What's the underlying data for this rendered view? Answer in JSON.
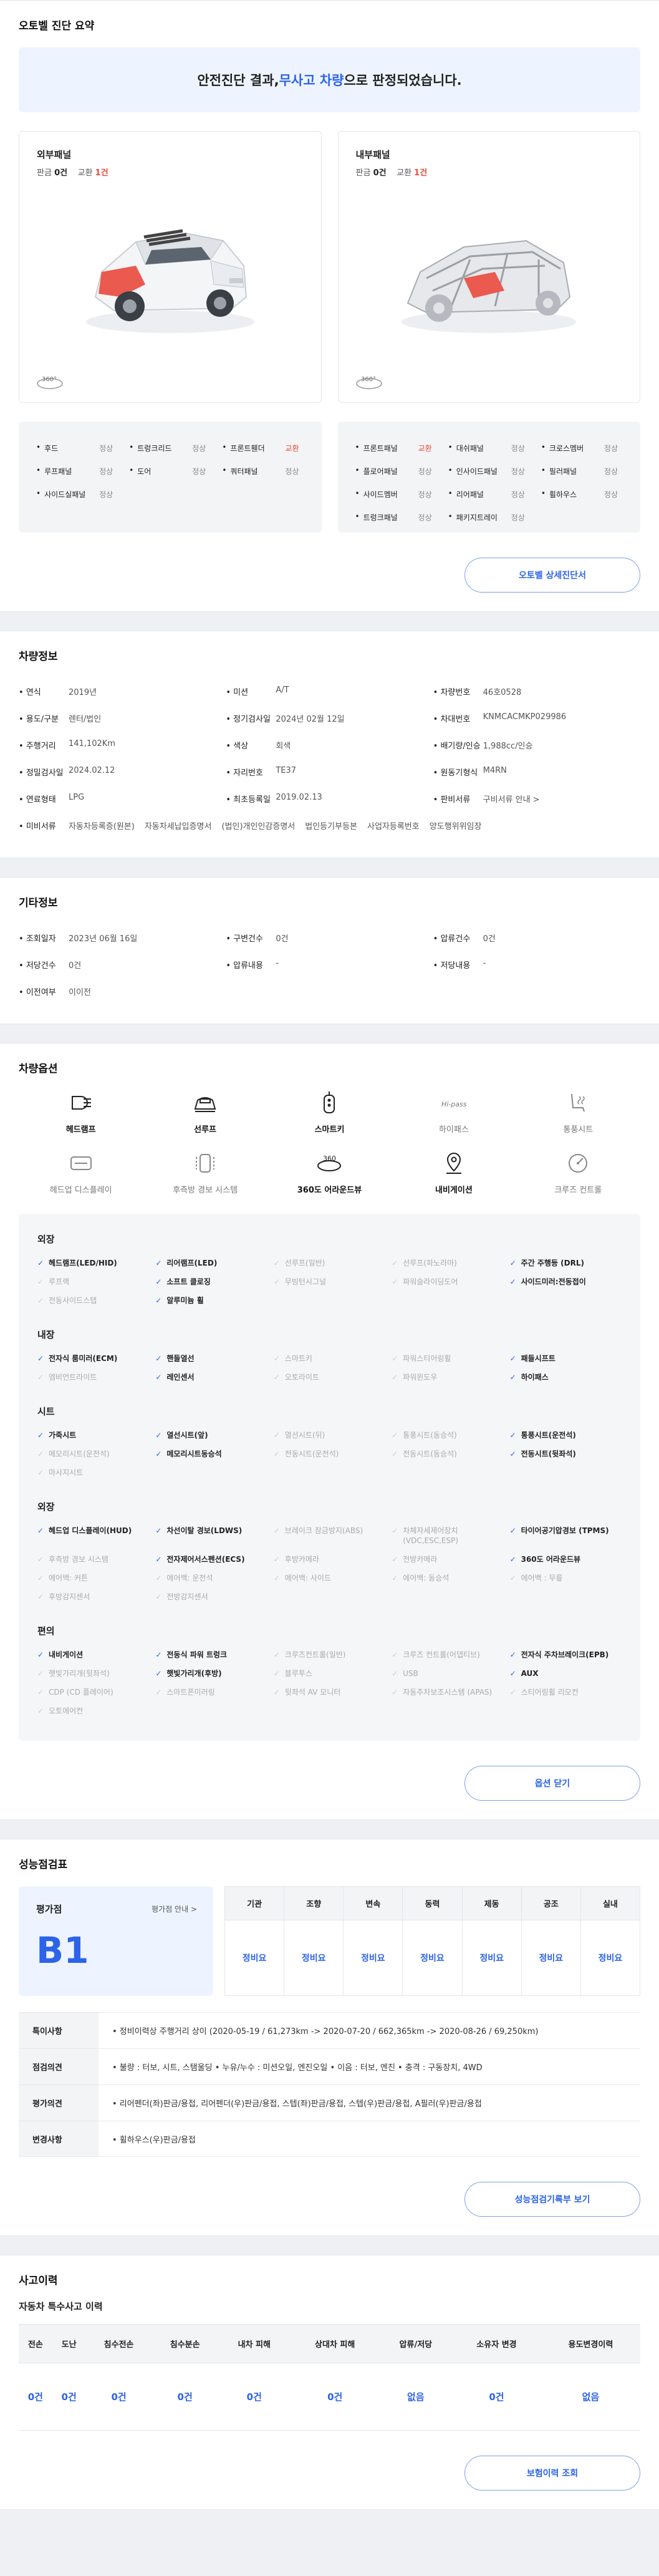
{
  "summary": {
    "title": "오토벨 진단 요약",
    "banner_pre": "안전진단 결과, ",
    "banner_hl": "무사고 차량",
    "banner_post": "으로 판정되었습니다.",
    "outer": {
      "title": "외부패널",
      "gum_label": "판금",
      "gum": "0건",
      "swap_label": "교환",
      "swap": "1건"
    },
    "inner": {
      "title": "내부패널",
      "gum_label": "판금",
      "gum": "0건",
      "swap_label": "교환",
      "swap": "1건"
    },
    "outer_parts": [
      {
        "n": "후드",
        "s": "정상"
      },
      {
        "n": "트렁크리드",
        "s": "정상"
      },
      {
        "n": "프론트휀더",
        "s": "교환"
      },
      {
        "n": "루프패널",
        "s": "정상"
      },
      {
        "n": "도어",
        "s": "정상"
      },
      {
        "n": "쿼터패널",
        "s": "정상"
      },
      {
        "n": "사이드실패널",
        "s": "정상"
      }
    ],
    "inner_parts": [
      {
        "n": "프론트패널",
        "s": "교환"
      },
      {
        "n": "대쉬패널",
        "s": "정상"
      },
      {
        "n": "크로스멤버",
        "s": "정상"
      },
      {
        "n": "플로어패널",
        "s": "정상"
      },
      {
        "n": "인사이드패널",
        "s": "정상"
      },
      {
        "n": "필러패널",
        "s": "정상"
      },
      {
        "n": "사이드멤버",
        "s": "정상"
      },
      {
        "n": "리어패널",
        "s": "정상"
      },
      {
        "n": "휠하우스",
        "s": "정상"
      },
      {
        "n": "트렁크패널",
        "s": "정상"
      },
      {
        "n": "패키지트레이",
        "s": "정상"
      }
    ],
    "detail_btn": "오토벨 상세진단서",
    "badge_360": "360°"
  },
  "car_info": {
    "title": "차량정보",
    "rows": [
      {
        "k": "연식",
        "v": "2019년"
      },
      {
        "k": "미션",
        "v": "A/T"
      },
      {
        "k": "차량번호",
        "v": "46호0528"
      },
      {
        "k": "용도/구분",
        "v": "렌터/법인"
      },
      {
        "k": "정기검사일",
        "v": "2024년 02월 12일"
      },
      {
        "k": "차대번호",
        "v": "KNMCACMKP029986"
      },
      {
        "k": "주행거리",
        "v": "141,102Km"
      },
      {
        "k": "색상",
        "v": "회색"
      },
      {
        "k": "배기량/인승",
        "v": "1,988cc/인승"
      },
      {
        "k": "정밀검사일",
        "v": "2024.02.12"
      },
      {
        "k": "자리번호",
        "v": "TE37"
      },
      {
        "k": "원동기형식",
        "v": "M4RN"
      },
      {
        "k": "연료형태",
        "v": "LPG"
      },
      {
        "k": "최초등록일",
        "v": "2019.02.13"
      },
      {
        "k": "판비서류",
        "v": "구비서류 안내 >"
      }
    ],
    "docs_label": "미비서류",
    "docs": [
      "자동차등록증(원본)",
      "자동차세납입증명서",
      "(법인)개인인감증명서",
      "법인등기부등본",
      "사업자등록번호",
      "양도행위위임장"
    ]
  },
  "etc_info": {
    "title": "기타정보",
    "rows": [
      {
        "k": "조회일자",
        "v": "2023년 06월 16일"
      },
      {
        "k": "구변건수",
        "v": "0건"
      },
      {
        "k": "압류건수",
        "v": "0건"
      },
      {
        "k": "저당건수",
        "v": "0건"
      },
      {
        "k": "압류내용",
        "v": "-"
      },
      {
        "k": "저당내용",
        "v": "-"
      },
      {
        "k": "이전여부",
        "v": "이이전"
      }
    ]
  },
  "options": {
    "title": "차량옵션",
    "close_btn": "옵션 닫기",
    "icons": [
      {
        "l": "헤드램프",
        "on": true,
        "i": "headlamp-icon"
      },
      {
        "l": "선루프",
        "on": true,
        "i": "sunroof-icon"
      },
      {
        "l": "스마트키",
        "on": true,
        "i": "smartkey-icon"
      },
      {
        "l": "하이패스",
        "on": false,
        "i": "hipass-icon"
      },
      {
        "l": "통풍시트",
        "on": false,
        "i": "ventseat-icon"
      },
      {
        "l": "헤드업 디스플레이",
        "on": false,
        "i": "hud-icon"
      },
      {
        "l": "후측방 경보 시스템",
        "on": false,
        "i": "blindspot-icon"
      },
      {
        "l": "360도 어라운드뷰",
        "on": true,
        "i": "around360-icon"
      },
      {
        "l": "내비게이션",
        "on": true,
        "i": "navigation-icon"
      },
      {
        "l": "크루즈 컨트롤",
        "on": false,
        "i": "cruise-icon"
      }
    ],
    "groups": [
      {
        "title": "외장",
        "items": [
          {
            "l": "헤드램프(LED/HID)",
            "on": true
          },
          {
            "l": "리어램프(LED)",
            "on": true
          },
          {
            "l": "선루프(일반)",
            "on": false
          },
          {
            "l": "선루프(파노라마)",
            "on": false
          },
          {
            "l": "주간 주행등 (DRL)",
            "on": true
          },
          {
            "l": "루프랙",
            "on": false
          },
          {
            "l": "소프트 클로징",
            "on": true
          },
          {
            "l": "무빙턴시그널",
            "on": false
          },
          {
            "l": "파워슬라이딩도어",
            "on": false
          },
          {
            "l": "사이드미러:전동접이",
            "on": true
          },
          {
            "l": "전동사이드스텝",
            "on": false
          },
          {
            "l": "알루미늄 휠",
            "on": true
          }
        ]
      },
      {
        "title": "내장",
        "items": [
          {
            "l": "전자식 룸미러(ECM)",
            "on": true
          },
          {
            "l": "핸들열선",
            "on": true
          },
          {
            "l": "스마트키",
            "on": false
          },
          {
            "l": "파워스티어링휠",
            "on": false
          },
          {
            "l": "패들시프트",
            "on": true
          },
          {
            "l": "엠비언트라이트",
            "on": false
          },
          {
            "l": "레인센서",
            "on": true
          },
          {
            "l": "오토라이트",
            "on": false
          },
          {
            "l": "파워윈도우",
            "on": false
          },
          {
            "l": "하이패스",
            "on": true
          }
        ]
      },
      {
        "title": "시트",
        "items": [
          {
            "l": "가죽시트",
            "on": true
          },
          {
            "l": "열선시트(앞)",
            "on": true
          },
          {
            "l": "열선시트(뒤)",
            "on": false
          },
          {
            "l": "통풍시트(동승석)",
            "on": false
          },
          {
            "l": "통풍시트(운전석)",
            "on": true
          },
          {
            "l": "메모리시트(운전석)",
            "on": false
          },
          {
            "l": "메모리시트동승석",
            "on": true
          },
          {
            "l": "전동시트(운전석)",
            "on": false
          },
          {
            "l": "전동시트(동승석)",
            "on": false
          },
          {
            "l": "전동시트(뒷좌석)",
            "on": true
          },
          {
            "l": "마사지시트",
            "on": false
          }
        ]
      },
      {
        "title": "외장",
        "items": [
          {
            "l": "헤드업 디스플레이(HUD)",
            "on": true
          },
          {
            "l": "차선이탈 경보(LDWS)",
            "on": true
          },
          {
            "l": "브레이크 잠금방지(ABS)",
            "on": false
          },
          {
            "l": "차체자세제어장치 (VDC,ESC,ESP)",
            "on": false
          },
          {
            "l": "타이어공기압경보 (TPMS)",
            "on": true
          },
          {
            "l": "후측방 경보 시스템",
            "on": false
          },
          {
            "l": "전자제어서스펜션(ECS)",
            "on": true
          },
          {
            "l": "후방카메라",
            "on": false
          },
          {
            "l": "전방카메라",
            "on": false
          },
          {
            "l": "360도 어라운드뷰",
            "on": true
          },
          {
            "l": "에어백: 커튼",
            "on": false
          },
          {
            "l": "에어백: 운전석",
            "on": false
          },
          {
            "l": "에어백: 사이드",
            "on": false
          },
          {
            "l": "에어백: 동승석",
            "on": false
          },
          {
            "l": "에어백 : 무릎",
            "on": false
          },
          {
            "l": "후방감지센서",
            "on": false
          },
          {
            "l": "전방감지센서",
            "on": false
          }
        ]
      },
      {
        "title": "편의",
        "items": [
          {
            "l": "내비게이션",
            "on": true
          },
          {
            "l": "전동식 파워 트렁크",
            "on": true
          },
          {
            "l": "크루즈컨트롤(일반)",
            "on": false
          },
          {
            "l": "크루즈 컨트롤(어댑티브)",
            "on": false
          },
          {
            "l": "전자식 주차브레이크(EPB)",
            "on": true
          },
          {
            "l": "햇빛가리개(뒷좌석)",
            "on": false
          },
          {
            "l": "햇빛가리개(후방)",
            "on": true
          },
          {
            "l": "블루투스",
            "on": false
          },
          {
            "l": "USB",
            "on": false
          },
          {
            "l": "AUX",
            "on": true
          },
          {
            "l": "CDP (CD 플레이어)",
            "on": false
          },
          {
            "l": "스마트폰미러링",
            "on": false
          },
          {
            "l": "뒷좌석 AV 모니터",
            "on": false
          },
          {
            "l": "자동주차보조시스템 (APAS)",
            "on": false
          },
          {
            "l": "스티어링휠 리모컨",
            "on": false
          },
          {
            "l": "오토에어컨",
            "on": false
          }
        ]
      }
    ]
  },
  "perf": {
    "title": "성능점검표",
    "grade_label": "평가점",
    "guide": "평가점 안내 >",
    "grade": "B1",
    "cols": [
      "기관",
      "조향",
      "변속",
      "동력",
      "제동",
      "공조",
      "실내"
    ],
    "vals": [
      "정비요",
      "정비요",
      "정비요",
      "정비요",
      "정비요",
      "정비요",
      "정비요"
    ],
    "rows": [
      {
        "k": "특이사항",
        "v": "• 정비이력상 주행거리 상이 (2020-05-19 / 61,273km -> 2020-07-20 / 662,365km -> 2020-08-26 / 69,250km)"
      },
      {
        "k": "점검의견",
        "v": "• 불량 : 터보, 시트, 스탬울딩   • 누유/누수 : 미션오일, 엔진오일   • 이음 : 터보, 엔진   • 충격 : 구동장치, 4WD"
      },
      {
        "k": "평가의견",
        "v": "• 리어펜더(좌)판금/용접, 리어펜더(우)판금/용접, 스텝(좌)판금/용접, 스텝(우)판금/용접, A필러(우)판금/용접"
      },
      {
        "k": "변경사항",
        "v": "• 휠하우스(우)판금/용접"
      }
    ],
    "btn": "성능점검기록부 보기"
  },
  "accident": {
    "title": "사고이력",
    "sub": "자동차 특수사고 이력",
    "cols": [
      "전손",
      "도난",
      "침수전손",
      "침수분손",
      "내차 피해",
      "상대차 피해",
      "압류/저당",
      "소유자 변경",
      "용도변경이력"
    ],
    "vals": [
      "0건",
      "0건",
      "0건",
      "0건",
      "0건",
      "0건",
      "없음",
      "0건",
      "없음"
    ],
    "btn": "보험이력 조회"
  }
}
